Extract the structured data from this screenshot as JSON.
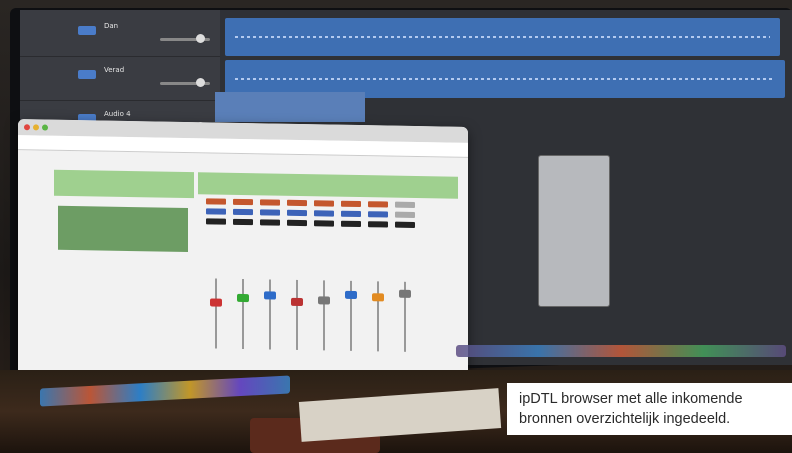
{
  "daw": {
    "tracks": [
      {
        "name": "Dan"
      },
      {
        "name": "Verad"
      },
      {
        "name": "Audio 4"
      }
    ]
  },
  "caption": {
    "line1": "ipDTL browser met alle inkomende",
    "line2": "bronnen overzichtelijk ingedeeld."
  },
  "colors": {
    "caption_bg": "#ffffff",
    "browser_accent": "#9fd08f",
    "waveform": "#3e6fb3"
  }
}
